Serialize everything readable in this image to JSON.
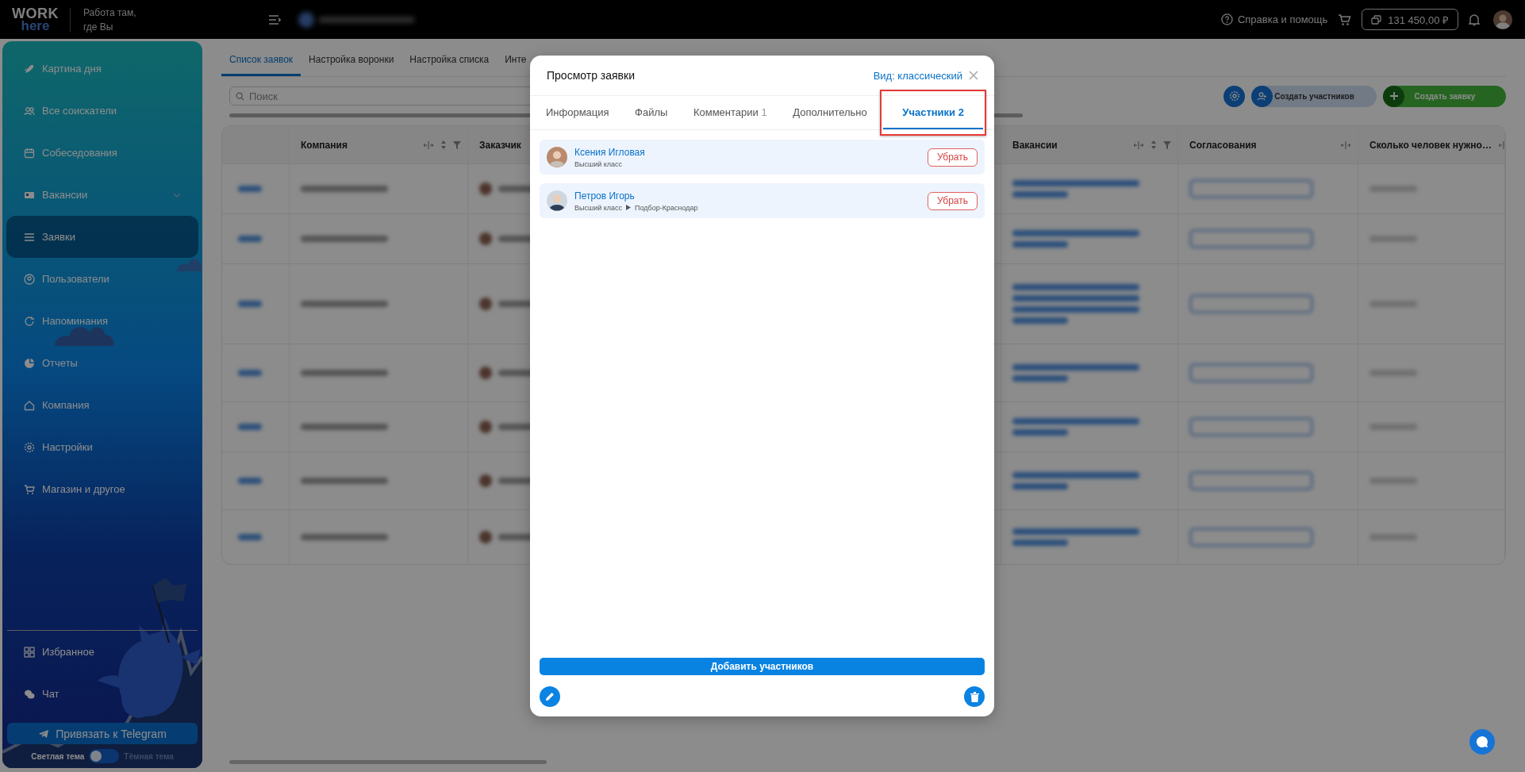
{
  "top_bar": {
    "logo": {
      "line_1": "WORK",
      "line_2": "here"
    },
    "slogan": [
      "Работа там,",
      "где Вы"
    ],
    "help": "Справка и помощь",
    "balance": "131 450,00 ₽"
  },
  "sidebar": {
    "items": [
      {
        "label": "Картина дня",
        "selected": false,
        "expandable": false
      },
      {
        "label": "Все соискатели",
        "selected": false,
        "expandable": false
      },
      {
        "label": "Собеседования",
        "selected": false,
        "expandable": false
      },
      {
        "label": "Вакансии",
        "selected": false,
        "expandable": true
      },
      {
        "label": "Заявки",
        "selected": true,
        "expandable": false
      },
      {
        "label": "Пользователи",
        "selected": false,
        "expandable": false
      },
      {
        "label": "Напоминания",
        "selected": false,
        "expandable": false
      },
      {
        "label": "Отчеты",
        "selected": false,
        "expandable": false
      },
      {
        "label": "Компания",
        "selected": false,
        "expandable": false
      },
      {
        "label": "Настройки",
        "selected": false,
        "expandable": false
      },
      {
        "label": "Магазин и другое",
        "selected": false,
        "expandable": false
      }
    ],
    "bottom_items": [
      {
        "label": "Избранное"
      },
      {
        "label": "Чат"
      }
    ],
    "telegram_button": "Привязать к Telegram",
    "theme": {
      "light_label": "Светлая тема",
      "dark_label": "Тёмная тема",
      "dark": false
    }
  },
  "page": {
    "tabs": [
      {
        "label": "Список заявок",
        "selected": true
      },
      {
        "label": "Настройка воронки",
        "selected": false
      },
      {
        "label": "Настройка списка",
        "selected": false
      },
      {
        "label": "Инте",
        "selected": false
      }
    ],
    "search": {
      "placeholder": "Поиск"
    },
    "actions": {
      "create_participants": "Создать участников",
      "create_request": "Создать заявку"
    },
    "table": {
      "columns": [
        {
          "label": "Компания",
          "sortable": true,
          "filterable": true
        },
        {
          "label": "Заказчик"
        },
        {
          "label": "Вакансии",
          "sortable": true,
          "filterable": true
        },
        {
          "label": "Согласования",
          "sortable": false,
          "filterable": false
        },
        {
          "label": "Сколько человек нужно…"
        }
      ]
    }
  },
  "modal": {
    "title": "Просмотр заявки",
    "view_link": "Вид: классический",
    "tabs": [
      {
        "label": "Информация",
        "selected": false,
        "highlighted": false
      },
      {
        "label": "Файлы",
        "selected": false,
        "highlighted": false
      },
      {
        "label": "Комментарии",
        "count": "1",
        "selected": false,
        "highlighted": false
      },
      {
        "label": "Дополнительно",
        "selected": false,
        "highlighted": false
      },
      {
        "label": "Участники",
        "count": "2",
        "selected": true,
        "highlighted": true
      }
    ],
    "participants": [
      {
        "name": "Ксения Игловая",
        "path": [
          "Высший класс"
        ],
        "remove": "Убрать"
      },
      {
        "name": "Петров Игорь",
        "path": [
          "Высший класс",
          "Подбор-Краснодар"
        ],
        "remove": "Убрать"
      }
    ],
    "add_button": "Добавить участников"
  }
}
